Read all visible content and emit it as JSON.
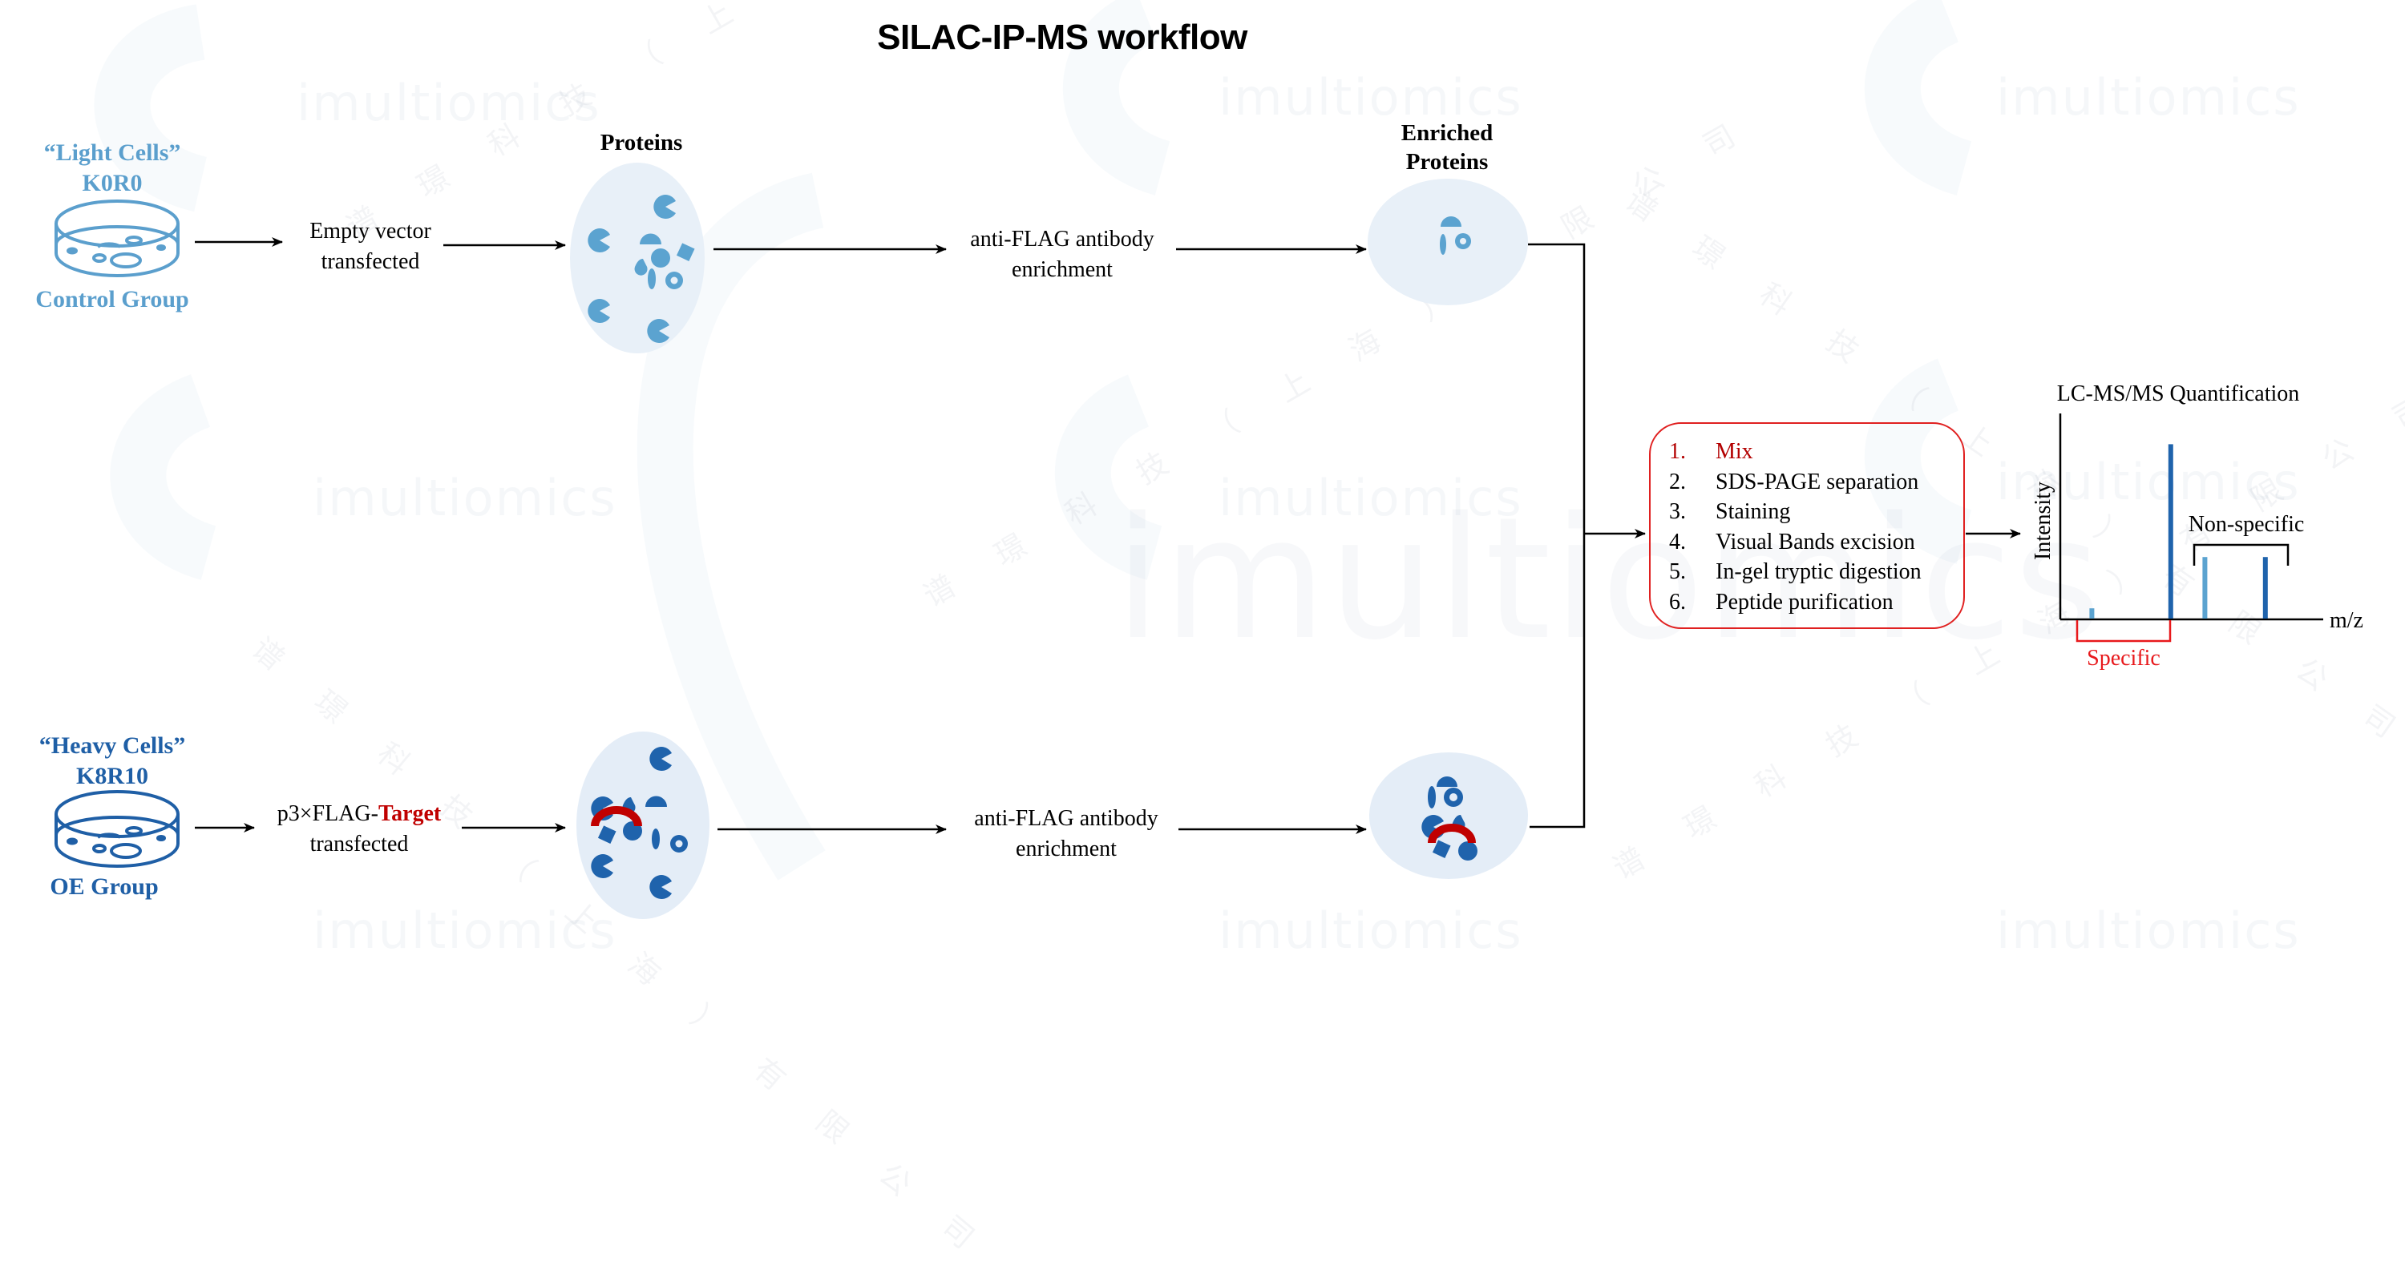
{
  "title": "SILAC-IP-MS workflow",
  "colors": {
    "light_blue": "#5b9fcd",
    "heavy_blue": "#1f5fa6",
    "protein_light": "#5ba3d0",
    "protein_heavy": "#1f63ac",
    "ellipse_fill": "#e6eef7",
    "bait_red": "#c00000",
    "box_border": "#e02020",
    "specific_red": "#e8191c",
    "arrow": "#000000"
  },
  "watermark": {
    "brand": "imultiomics",
    "company_cn": "谱 璟 科 技 （ 上 海 ） 有 限 公 司"
  },
  "light_group": {
    "name": "“Light Cells”",
    "label": "K0R0",
    "group": "Control Group",
    "icon": "petri-dish-icon",
    "transfection_line1": "Empty vector",
    "transfection_line2": "transfected",
    "proteins_label": "Proteins",
    "enrichment_line1": "anti-FLAG antibody",
    "enrichment_line2": "enrichment",
    "enriched_label_line1": "Enriched",
    "enriched_label_line2": "Proteins"
  },
  "heavy_group": {
    "name": "“Heavy Cells”",
    "label": "K8R10",
    "group": "OE Group",
    "icon": "petri-dish-icon",
    "transfection_prefix": "p3×FLAG-",
    "transfection_target": "Target",
    "transfection_line2": "transfected",
    "enrichment_line1": "anti-FLAG antibody",
    "enrichment_line2": "enrichment"
  },
  "process_steps": [
    {
      "num": "1.",
      "text": "Mix",
      "highlight": true
    },
    {
      "num": "2.",
      "text": "SDS-PAGE separation",
      "highlight": false
    },
    {
      "num": "3.",
      "text": "Staining",
      "highlight": false
    },
    {
      "num": "4.",
      "text": "Visual Bands excision",
      "highlight": false
    },
    {
      "num": "5.",
      "text": "In-gel tryptic digestion",
      "highlight": false
    },
    {
      "num": "6.",
      "text": "Peptide purification",
      "highlight": false
    }
  ],
  "chart_data": {
    "type": "bar",
    "title": "LC-MS/MS Quantification",
    "xlabel": "m/z",
    "ylabel": "Intensity",
    "ylim": [
      0,
      1
    ],
    "grid": false,
    "x": [
      0.12,
      0.42,
      0.55,
      0.78
    ],
    "values": [
      0.05,
      0.85,
      0.3,
      0.3
    ],
    "series_labels": [
      "light",
      "heavy",
      "light",
      "heavy"
    ],
    "annotations": [
      {
        "text": "Specific",
        "covers": [
          0,
          1
        ],
        "position": "below",
        "color": "#e8191c"
      },
      {
        "text": "Non-specific",
        "covers": [
          2,
          3
        ],
        "position": "above",
        "color": "#000000"
      }
    ]
  }
}
